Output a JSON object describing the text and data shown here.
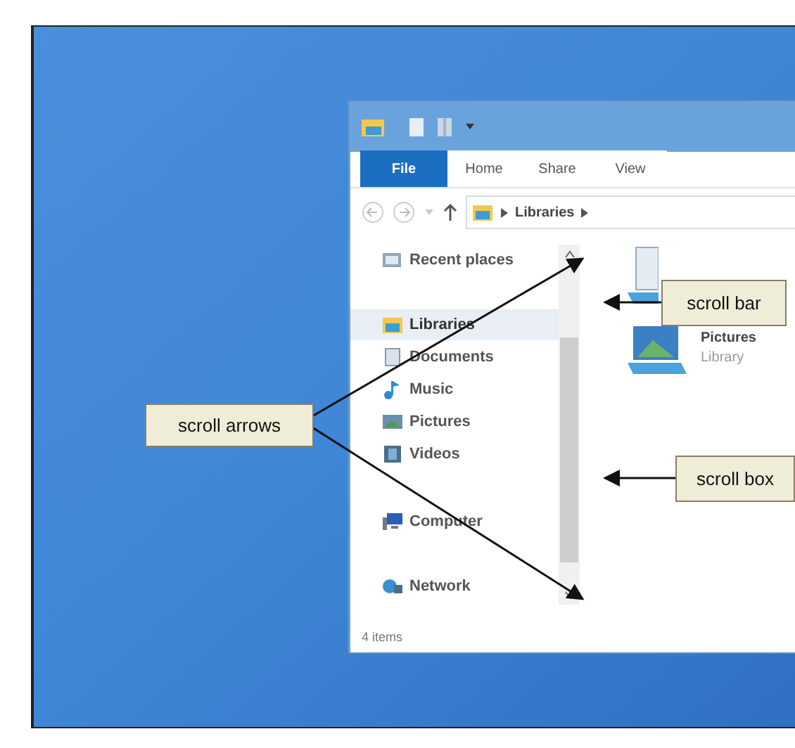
{
  "ribbon_tabs": [
    {
      "label": "File",
      "selected": true
    },
    {
      "label": "Home",
      "selected": false
    },
    {
      "label": "Share",
      "selected": false
    },
    {
      "label": "View",
      "selected": false
    }
  ],
  "address_bar": {
    "path": [
      "Libraries"
    ]
  },
  "navigation_pane": {
    "items": [
      {
        "label": "Recent places",
        "kind": "recent",
        "selected": false
      },
      {
        "label": "Libraries",
        "kind": "library",
        "selected": true,
        "children": [
          {
            "label": "Documents",
            "kind": "documents",
            "selected": false
          },
          {
            "label": "Music",
            "kind": "music",
            "selected": false
          },
          {
            "label": "Pictures",
            "kind": "pictures",
            "selected": false
          },
          {
            "label": "Videos",
            "kind": "videos",
            "selected": false
          }
        ]
      },
      {
        "label": "Computer",
        "kind": "computer",
        "selected": false
      },
      {
        "label": "Network",
        "kind": "network",
        "selected": false
      }
    ]
  },
  "content_items": [
    {
      "name": "Pictures",
      "subtitle": "Library"
    }
  ],
  "status_bar": "4 items",
  "callouts": [
    {
      "label": "scroll arrows",
      "kind": "arrows"
    },
    {
      "label": "scroll bar",
      "kind": "bar"
    },
    {
      "label": "scroll box",
      "kind": "box"
    }
  ]
}
